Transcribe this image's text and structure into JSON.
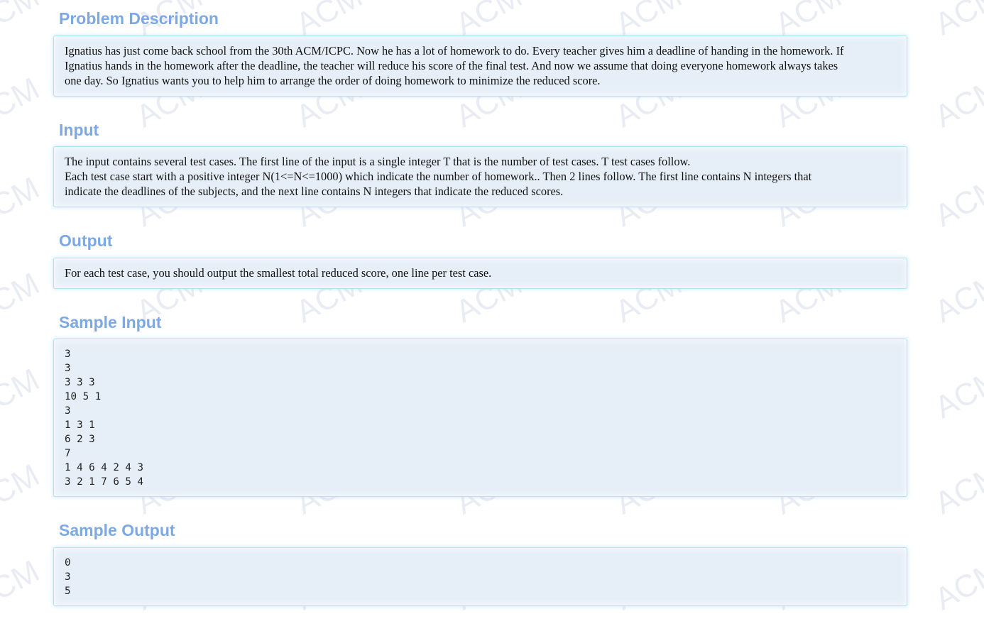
{
  "sections": {
    "problem_description": {
      "title": "Problem Description",
      "lines": [
        "Ignatius has just come back school from the 30th ACM/ICPC. Now he has a lot of homework to do. Every teacher gives him a deadline of handing in the homework. If",
        "Ignatius hands in the homework after the deadline, the teacher will reduce his score of the final test. And now we assume that doing everyone homework always takes",
        "one day. So Ignatius wants you to help him to arrange the order of doing homework to minimize the reduced score."
      ]
    },
    "input": {
      "title": "Input",
      "lines": [
        "The input contains several test cases. The first line of the input is a single integer T that is the number of test cases. T test cases follow.",
        "Each test case start with a positive integer N(1<=N<=1000) which indicate the number of homework.. Then 2 lines follow. The first line contains N integers that",
        "indicate the deadlines of the subjects, and the next line contains N integers that indicate the reduced scores."
      ]
    },
    "output": {
      "title": "Output",
      "lines": [
        "For each test case, you should output the smallest total reduced score, one line per test case."
      ]
    },
    "sample_input": {
      "title": "Sample Input",
      "lines": [
        "3",
        "3",
        "3 3 3",
        "10 5 1",
        "3",
        "1 3 1",
        "6 2 3",
        "7",
        "1 4 6 4 2 4 3",
        "3 2 1 7 6 5 4"
      ]
    },
    "sample_output": {
      "title": "Sample Output",
      "lines": [
        "0",
        "3",
        "5"
      ]
    }
  },
  "watermark_text": "ACM",
  "colors": {
    "title": "#7ca9e6",
    "panel_bg": "#e6eff8",
    "panel_border": "#aee4f4",
    "text": "#111111"
  }
}
